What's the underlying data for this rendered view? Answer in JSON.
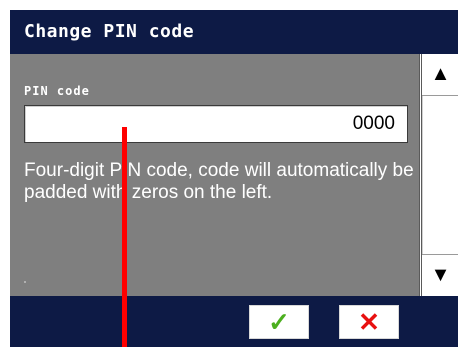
{
  "dialog": {
    "title": "Change PIN code"
  },
  "pin": {
    "label": "PIN code",
    "value": "0000",
    "help": "Four-digit PIN code, code will automatically be padded with zeros on the left."
  },
  "scrollbar": {
    "up_icon": "▲",
    "down_icon": "▼"
  },
  "actions": {
    "ok_icon": "✓",
    "cancel_icon": "✕"
  },
  "colors": {
    "title_bg": "#0d1a45",
    "panel_bg": "#7f7f7f",
    "ok": "#4caf1f",
    "cancel": "#e81010",
    "marker": "#ff0000"
  }
}
